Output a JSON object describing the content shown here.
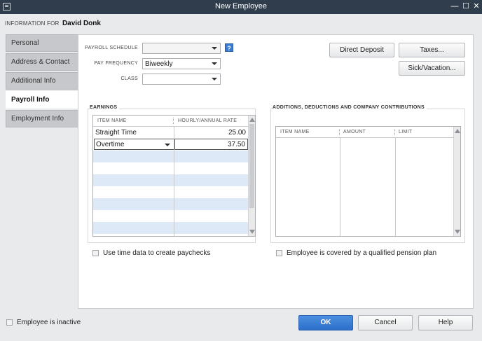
{
  "window": {
    "title": "New Employee",
    "minimize": "—",
    "maximize": "☐",
    "close": "✕"
  },
  "info": {
    "label": "INFORMATION FOR",
    "name": "David Donk"
  },
  "tabs": [
    {
      "label": "Personal"
    },
    {
      "label": "Address & Contact"
    },
    {
      "label": "Additional Info"
    },
    {
      "label": "Payroll Info"
    },
    {
      "label": "Employment Info"
    }
  ],
  "payroll": {
    "schedule_label": "PAYROLL SCHEDULE",
    "schedule_value": "",
    "frequency_label": "PAY FREQUENCY",
    "frequency_value": "Biweekly",
    "class_label": "CLASS",
    "class_value": "",
    "help": "?"
  },
  "buttons": {
    "direct_deposit": "Direct Deposit",
    "taxes": "Taxes...",
    "sick_vacation": "Sick/Vacation...",
    "ok": "OK",
    "cancel": "Cancel",
    "help": "Help"
  },
  "earnings": {
    "title": "EARNINGS",
    "col_item": "ITEM NAME",
    "col_rate": "HOURLY/ANNUAL RATE",
    "rows": [
      {
        "item": "Straight Time",
        "rate": "25.00"
      },
      {
        "item": "Overtime",
        "rate": "37.50"
      }
    ]
  },
  "deductions": {
    "title": "ADDITIONS, DEDUCTIONS AND COMPANY CONTRIBUTIONS",
    "col_item": "ITEM NAME",
    "col_amount": "AMOUNT",
    "col_limit": "LIMIT"
  },
  "checkboxes": {
    "time_data": "Use time data to create paychecks",
    "pension": "Employee is covered by a qualified pension plan",
    "inactive": "Employee is inactive"
  },
  "colors": {
    "titlebar": "#2f3d4c",
    "accent": "#2d6fc9",
    "row_alt": "#dde9f7"
  }
}
